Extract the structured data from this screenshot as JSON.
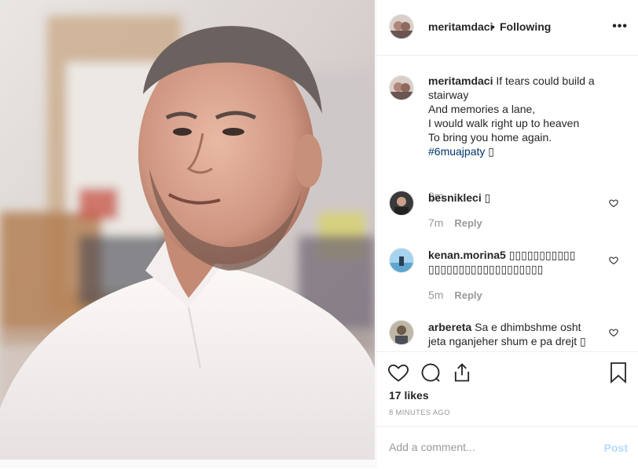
{
  "header": {
    "username": "meritamdaci",
    "separator": "•",
    "follow_status": "Following",
    "more_glyph": "•••"
  },
  "caption": {
    "username": "meritamdaci",
    "lines": [
      "If tears could build a",
      "stairway",
      "And memories a lane,",
      "I would walk right up to heaven",
      "To bring you home again."
    ],
    "hashtag": "#6muajpaty",
    "emoji": "▯",
    "time": "8m"
  },
  "comments": [
    {
      "username": "besnikleci",
      "text": "▯",
      "time": "7m",
      "reply_label": "Reply"
    },
    {
      "username": "kenan.morina5",
      "text_line1": "▯▯▯▯▯▯▯▯▯▯▯",
      "text_line2": "▯▯▯▯▯▯▯▯▯▯▯▯▯▯▯▯▯▯▯",
      "time": "5m",
      "reply_label": "Reply"
    },
    {
      "username": "arbereta",
      "text_line1": "Sa e dhimbshme osht",
      "text_line2": "jeta nganjeher shum e pa drejt ▯"
    }
  ],
  "actions": {
    "like_icon": "heart-icon",
    "comment_icon": "comment-icon",
    "share_icon": "share-icon",
    "save_icon": "bookmark-icon"
  },
  "likes": "17 likes",
  "time_ago": "8 MINUTES AGO",
  "add_comment": {
    "placeholder": "Add a comment...",
    "post_label": "Post"
  },
  "colors": {
    "link": "#003569",
    "muted": "#999999",
    "post_disabled": "#b3dbff",
    "border": "#efefef"
  }
}
